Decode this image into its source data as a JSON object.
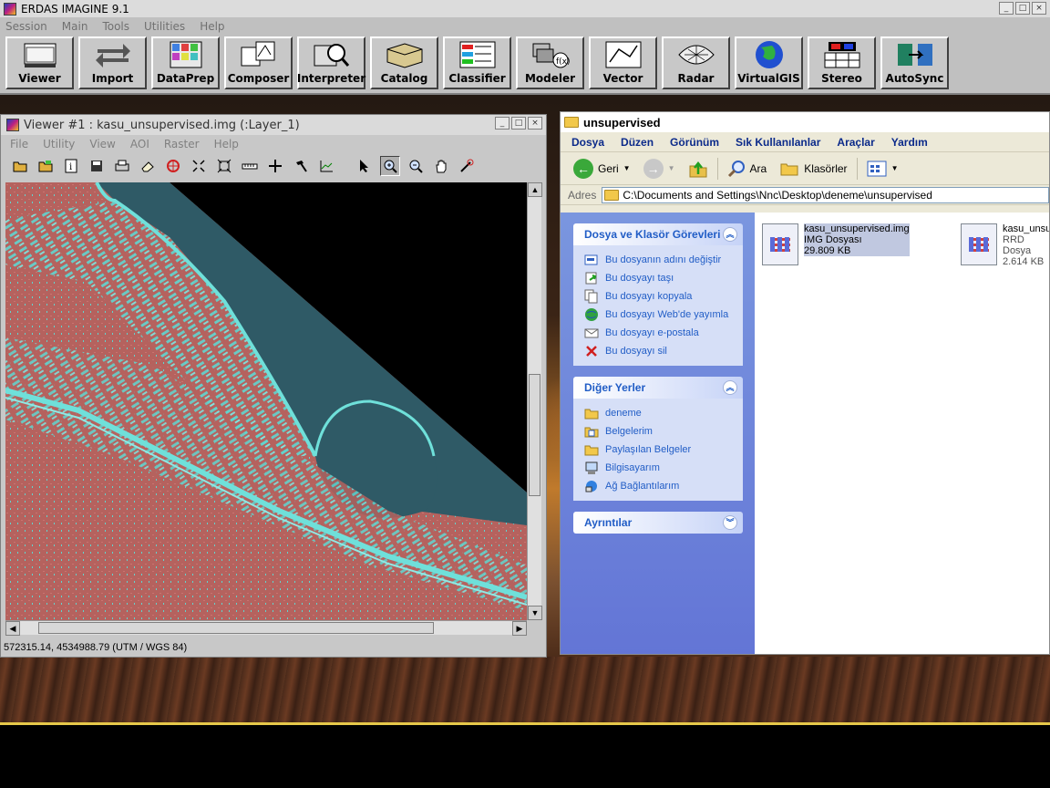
{
  "erdas": {
    "title": "ERDAS IMAGINE 9.1",
    "menu": [
      "Session",
      "Main",
      "Tools",
      "Utilities",
      "Help"
    ],
    "tools": [
      {
        "label": "Viewer",
        "icon": "viewer-icon"
      },
      {
        "label": "Import",
        "icon": "import-icon"
      },
      {
        "label": "DataPrep",
        "icon": "dataprep-icon"
      },
      {
        "label": "Composer",
        "icon": "composer-icon"
      },
      {
        "label": "Interpreter",
        "icon": "interpreter-icon"
      },
      {
        "label": "Catalog",
        "icon": "catalog-icon"
      },
      {
        "label": "Classifier",
        "icon": "classifier-icon"
      },
      {
        "label": "Modeler",
        "icon": "modeler-icon"
      },
      {
        "label": "Vector",
        "icon": "vector-icon"
      },
      {
        "label": "Radar",
        "icon": "radar-icon"
      },
      {
        "label": "VirtualGIS",
        "icon": "globe-icon"
      },
      {
        "label": "Stereo",
        "icon": "stereo-icon"
      },
      {
        "label": "AutoSync",
        "icon": "autosync-icon"
      }
    ]
  },
  "viewer": {
    "title": "Viewer #1 : kasu_unsupervised.img (:Layer_1)",
    "menu": [
      "File",
      "Utility",
      "View",
      "AOI",
      "Raster",
      "Help"
    ],
    "status": "572315.14, 4534988.79   (UTM / WGS 84)"
  },
  "explorer": {
    "title": "unsupervised",
    "menu": [
      "Dosya",
      "Düzen",
      "Görünüm",
      "Sık Kullanılanlar",
      "Araçlar",
      "Yardım"
    ],
    "back_label": "Geri",
    "search_label": "Ara",
    "folders_label": "Klasörler",
    "address_label": "Adres",
    "address_value": "C:\\Documents and Settings\\Nnc\\Desktop\\deneme\\unsupervised",
    "tasks_panel": {
      "title": "Dosya ve Klasör Görevleri",
      "items": [
        "Bu dosyanın adını değiştir",
        "Bu dosyayı taşı",
        "Bu dosyayı kopyala",
        "Bu dosyayı Web'de yayımla",
        "Bu dosyayı e-postala",
        "Bu dosyayı sil"
      ]
    },
    "places_panel": {
      "title": "Diğer Yerler",
      "items": [
        "deneme",
        "Belgelerim",
        "Paylaşılan Belgeler",
        "Bilgisayarım",
        "Ağ Bağlantılarım"
      ]
    },
    "details_panel": {
      "title": "Ayrıntılar"
    },
    "files": [
      {
        "name": "kasu_unsupervised.img",
        "type": "IMG Dosyası",
        "size": "29.809 KB"
      },
      {
        "name": "kasu_unsu",
        "type": "RRD Dosya",
        "size": "2.614 KB"
      }
    ]
  },
  "colors": {
    "map_land": "#b5625e",
    "map_urban": "#5fd6d0",
    "map_water": "#2f5a66",
    "map_nodata": "#000000"
  }
}
